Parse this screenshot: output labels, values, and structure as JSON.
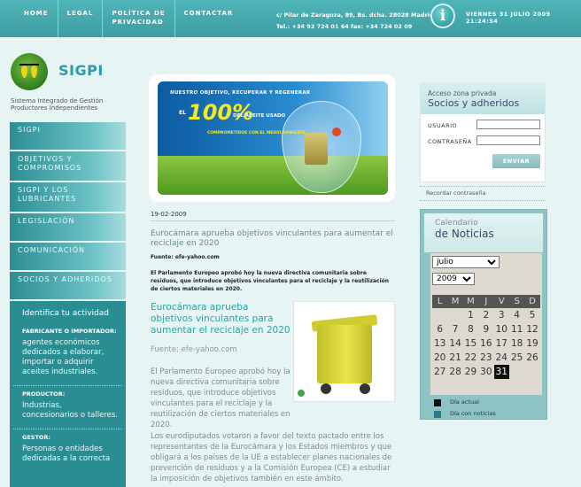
{
  "topnav": [
    "HOME",
    "LEGAL",
    "POLÍTICA DE\nPRIVACIDAD",
    "CONTACTAR"
  ],
  "header": {
    "address_line1": "c/ Pilar de Zaragoza, 89, Bs. dcha.   28028 Madrid",
    "address_line2": "Tel.: +34 92 724 01 64   fax: +34 724 02 09",
    "info_icon": "i",
    "date": "VIERNES 31 JULIO 2009",
    "time": "21:24:54"
  },
  "brand": {
    "name": "SIGPI",
    "subtitle_line1": "Sistema Integrado de Gestión",
    "subtitle_line2": "Productores Independientes"
  },
  "left_menu": [
    "SIGPI",
    "OBJETIVOS Y\nCOMPROMISOS",
    "SIGPI Y LOS\nLUBRICANTES",
    "LEGISLACIÓN",
    "COMUNICACIÓN",
    "SOCIOS Y ADHERIDOS"
  ],
  "activity": {
    "title": "Identifica tu actividad",
    "items": [
      {
        "category": "FABRICANTE O IMPORTADOR:",
        "desc": "agentes económicos dedicados a elaborar, importar o adquirir aceites industriales."
      },
      {
        "category": "PRODUCTOR:",
        "desc": "Industrias, concesionarios o talleres."
      },
      {
        "category": "GESTOR:",
        "desc": "Personas o entidades dedicadas a la correcta"
      }
    ]
  },
  "banner": {
    "line1": "NUESTRO OBJETIVO, RECUPERAR Y REGENERAR",
    "el": "EL",
    "percent": "100%",
    "line2": "DEL ACEITE USADO",
    "line3": "COMPROMETIDOS CON EL MEDIO AMBIENTE"
  },
  "news": {
    "date": "19-02-2009",
    "title": "Eurocámara aprueba objetivos vinculantes para aumentar el reciclaje en 2020",
    "source": "Fuente: efe-yahoo.com",
    "summary": "El Parlamento Europeo aprobó hoy la nueva directiva comunitaria sobre residuos, que introduce objetivos vinculantes para el reciclaje y la reutilización de ciertos materiales en 2020.",
    "headline": "Eurocámara aprueba objetivos vinculantes para aumentar el reciclaje en 2020",
    "source2": "Fuente: efe-yahoo.com",
    "body1": "El Parlamento Europeo aprobó hoy la nueva directiva comunitaria sobre residuos, que introduce objetivos vinculantes para el reciclaje y la reutilización de ciertos materiales en 2020.",
    "body2": "Los eurodiputados votaron a favor del texto pactado entre los representantes de la Eurocámara y los Estados miembros y que obligará a los países de la UE a establecer planes nacionales de prevención de residuos y a la Comisión Europea (CE) a estudiar la imposición de objetivos también en este ámbito."
  },
  "login": {
    "heading_small": "Acceso zona privada",
    "heading": "Socios y adheridos",
    "user_label": "USUARIO",
    "user_value": "",
    "password_label": "CONTRASEÑA",
    "password_value": "",
    "submit": "ENVIAR",
    "forgot": "Recordar contraseña"
  },
  "calendar": {
    "heading_small": "Calendario",
    "heading": "de Noticias",
    "month": "julio",
    "year": "2009",
    "weekdays": [
      "L",
      "M",
      "M",
      "J",
      "V",
      "S",
      "D"
    ],
    "weeks": [
      [
        "",
        "",
        "1",
        "2",
        "3",
        "4",
        "5"
      ],
      [
        "6",
        "7",
        "8",
        "9",
        "10",
        "11",
        "12"
      ],
      [
        "13",
        "14",
        "15",
        "16",
        "17",
        "18",
        "19"
      ],
      [
        "20",
        "21",
        "22",
        "23",
        "24",
        "25",
        "26"
      ],
      [
        "27",
        "28",
        "29",
        "30",
        "31",
        "",
        ""
      ]
    ],
    "today": "31",
    "legend_today": "Día actual",
    "legend_news": "Día con noticias",
    "today_color": "#111111",
    "news_color": "#2a7f86"
  }
}
